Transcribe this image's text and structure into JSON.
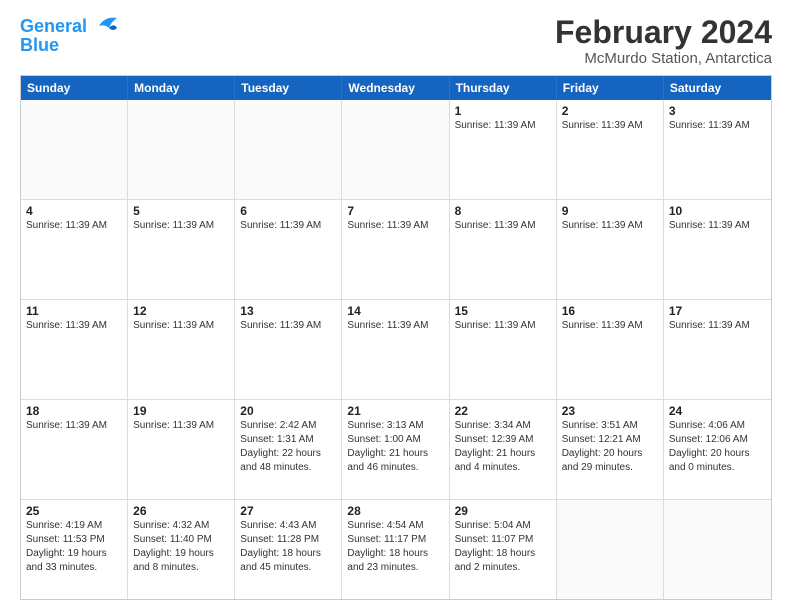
{
  "header": {
    "logo_line1": "General",
    "logo_line2": "Blue",
    "month_year": "February 2024",
    "location": "McMurdo Station, Antarctica"
  },
  "weekdays": [
    "Sunday",
    "Monday",
    "Tuesday",
    "Wednesday",
    "Thursday",
    "Friday",
    "Saturday"
  ],
  "rows": [
    [
      {
        "day": "",
        "info": []
      },
      {
        "day": "",
        "info": []
      },
      {
        "day": "",
        "info": []
      },
      {
        "day": "",
        "info": []
      },
      {
        "day": "1",
        "info": [
          "Sunrise: 11:39 AM"
        ]
      },
      {
        "day": "2",
        "info": [
          "Sunrise: 11:39 AM"
        ]
      },
      {
        "day": "3",
        "info": [
          "Sunrise: 11:39 AM"
        ]
      }
    ],
    [
      {
        "day": "4",
        "info": [
          "Sunrise: 11:39 AM"
        ]
      },
      {
        "day": "5",
        "info": [
          "Sunrise: 11:39 AM"
        ]
      },
      {
        "day": "6",
        "info": [
          "Sunrise: 11:39 AM"
        ]
      },
      {
        "day": "7",
        "info": [
          "Sunrise: 11:39 AM"
        ]
      },
      {
        "day": "8",
        "info": [
          "Sunrise: 11:39 AM"
        ]
      },
      {
        "day": "9",
        "info": [
          "Sunrise: 11:39 AM"
        ]
      },
      {
        "day": "10",
        "info": [
          "Sunrise: 11:39 AM"
        ]
      }
    ],
    [
      {
        "day": "11",
        "info": [
          "Sunrise: 11:39 AM"
        ]
      },
      {
        "day": "12",
        "info": [
          "Sunrise: 11:39 AM"
        ]
      },
      {
        "day": "13",
        "info": [
          "Sunrise: 11:39 AM"
        ]
      },
      {
        "day": "14",
        "info": [
          "Sunrise: 11:39 AM"
        ]
      },
      {
        "day": "15",
        "info": [
          "Sunrise: 11:39 AM"
        ]
      },
      {
        "day": "16",
        "info": [
          "Sunrise: 11:39 AM"
        ]
      },
      {
        "day": "17",
        "info": [
          "Sunrise: 11:39 AM"
        ]
      }
    ],
    [
      {
        "day": "18",
        "info": [
          "Sunrise: 11:39 AM"
        ]
      },
      {
        "day": "19",
        "info": [
          "Sunrise: 11:39 AM"
        ]
      },
      {
        "day": "20",
        "info": [
          "Sunrise: 2:42 AM",
          "Sunset: 1:31 AM",
          "Daylight: 22 hours and 48 minutes."
        ]
      },
      {
        "day": "21",
        "info": [
          "Sunrise: 3:13 AM",
          "Sunset: 1:00 AM",
          "Daylight: 21 hours and 46 minutes."
        ]
      },
      {
        "day": "22",
        "info": [
          "Sunrise: 3:34 AM",
          "Sunset: 12:39 AM",
          "Daylight: 21 hours and 4 minutes."
        ]
      },
      {
        "day": "23",
        "info": [
          "Sunrise: 3:51 AM",
          "Sunset: 12:21 AM",
          "Daylight: 20 hours and 29 minutes."
        ]
      },
      {
        "day": "24",
        "info": [
          "Sunrise: 4:06 AM",
          "Sunset: 12:06 AM",
          "Daylight: 20 hours and 0 minutes."
        ]
      }
    ],
    [
      {
        "day": "25",
        "info": [
          "Sunrise: 4:19 AM",
          "Sunset: 11:53 PM",
          "Daylight: 19 hours and 33 minutes."
        ]
      },
      {
        "day": "26",
        "info": [
          "Sunrise: 4:32 AM",
          "Sunset: 11:40 PM",
          "Daylight: 19 hours and 8 minutes."
        ]
      },
      {
        "day": "27",
        "info": [
          "Sunrise: 4:43 AM",
          "Sunset: 11:28 PM",
          "Daylight: 18 hours and 45 minutes."
        ]
      },
      {
        "day": "28",
        "info": [
          "Sunrise: 4:54 AM",
          "Sunset: 11:17 PM",
          "Daylight: 18 hours and 23 minutes."
        ]
      },
      {
        "day": "29",
        "info": [
          "Sunrise: 5:04 AM",
          "Sunset: 11:07 PM",
          "Daylight: 18 hours and 2 minutes."
        ]
      },
      {
        "day": "",
        "info": []
      },
      {
        "day": "",
        "info": []
      }
    ]
  ]
}
